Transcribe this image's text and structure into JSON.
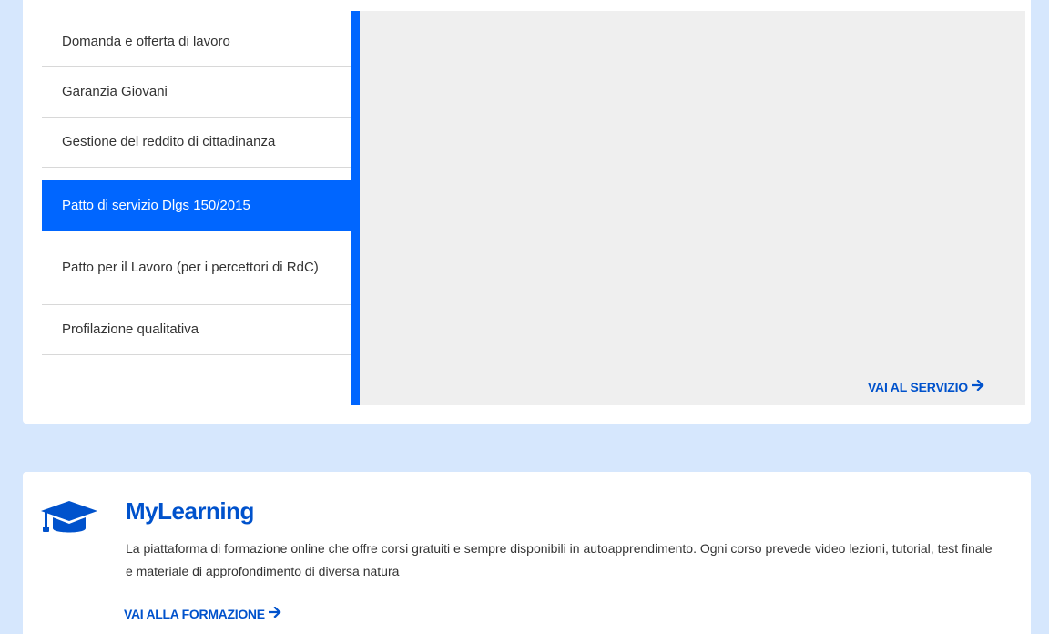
{
  "services": {
    "menu": [
      {
        "label": "Domanda e offerta di lavoro",
        "active": false
      },
      {
        "label": "Garanzia Giovani",
        "active": false
      },
      {
        "label": "Gestione del reddito di cittadinanza",
        "active": false
      },
      {
        "label": "Patto di servizio Dlgs 150/2015",
        "active": true
      },
      {
        "label": "Patto per il Lavoro (per i percettori di RdC)",
        "active": false
      },
      {
        "label": "Profilazione qualitativa",
        "active": false
      }
    ],
    "link_label": "VAI AL SERVIZIO",
    "link_icon": "arrow-right-icon"
  },
  "mylearning": {
    "icon": "graduation-cap-icon",
    "title": "MyLearning",
    "description": "La piattaforma di formazione online che offre corsi gratuiti e sempre disponibili in autoapprendimento. Ogni corso prevede video lezioni, tutorial, test finale e materiale di approfondimento di diversa natura",
    "link_label": "VAI ALLA FORMAZIONE",
    "link_icon": "arrow-right-icon"
  },
  "colors": {
    "page_background": "#d6e7fd",
    "accent": "#0066ff",
    "link": "#0052cc",
    "panel": "#efefef"
  }
}
